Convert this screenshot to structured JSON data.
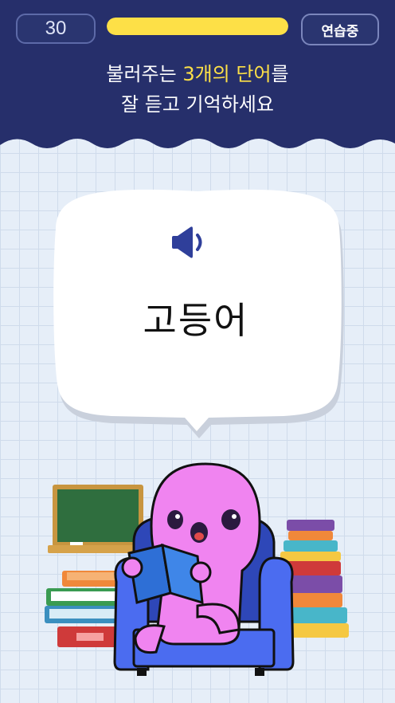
{
  "header": {
    "timer": "30",
    "progress": 1.0,
    "progress_color": "#fde047",
    "practice_label": "연습중",
    "instruction_line1_a": "불러주는 ",
    "instruction_line1_hl": "3개의 단어",
    "instruction_line1_b": "를",
    "instruction_line2": "잘 듣고 기억하세요",
    "background_color": "#262f6b"
  },
  "card": {
    "speaker_icon": "speaker-icon",
    "word": "고등어"
  },
  "illustration": {
    "character": "pink octopus reading a book in armchair",
    "icons": [
      "chalkboard-icon",
      "book-stack-icon"
    ]
  }
}
